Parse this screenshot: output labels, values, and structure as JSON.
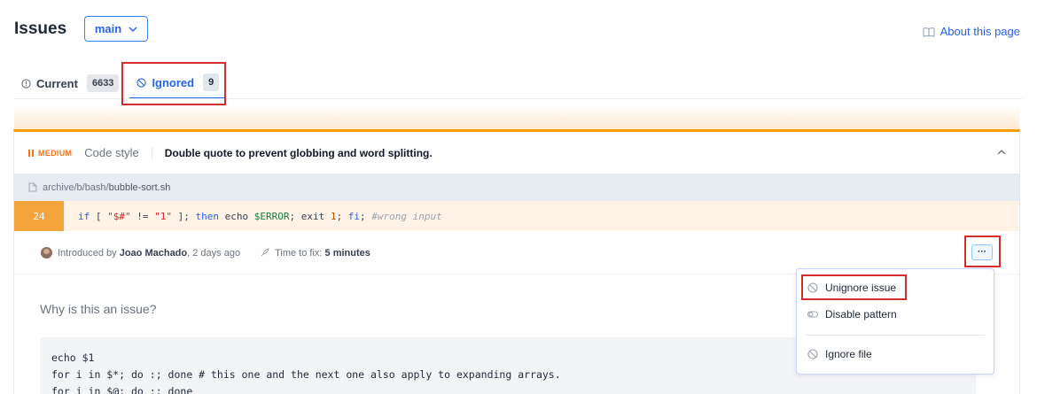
{
  "header": {
    "title": "Issues",
    "branch": "main",
    "about_link": "About this page"
  },
  "tabs": [
    {
      "label": "Current",
      "count": "6633",
      "icon": "info-icon",
      "active": false
    },
    {
      "label": "Ignored",
      "count": "9",
      "icon": "ban-icon",
      "active": true
    }
  ],
  "issue": {
    "severity": "MEDIUM",
    "category": "Code style",
    "title": "Double quote to prevent globbing and word splitting.",
    "file_path": "archive/b/bash/",
    "file_name": "bubble-sort.sh",
    "line_number": "24",
    "code": {
      "t1": "if",
      "t2": " [ ",
      "t3": "\"$#\"",
      "t4": " != ",
      "t5": "\"1\"",
      "t6": " ]; ",
      "t7": "then",
      "t8": " echo ",
      "t9": "$ERROR",
      "t10": "; exit ",
      "t11": "1",
      "t12": "; ",
      "t13": "fi",
      "t14": "; ",
      "t15": "#wrong input"
    },
    "introduced_prefix": "Introduced by",
    "author": "Joao Machado",
    "introduced_suffix": ", 2 days ago",
    "time_to_fix_label": "Time to fix:",
    "time_to_fix": "5 minutes",
    "more_label": "···",
    "why_heading": "Why is this an issue?",
    "example_code": "echo $1\nfor i in $*; do :; done # this one and the next one also apply to expanding arrays.\nfor i in $@; do :; done"
  },
  "menu": {
    "items": [
      {
        "label": "Unignore issue",
        "icon": "ban-icon"
      },
      {
        "label": "Disable pattern",
        "icon": "toggle-icon"
      },
      {
        "label": "Ignore file",
        "icon": "ban-icon"
      }
    ]
  },
  "colors": {
    "accent": "#2563eb",
    "severity_medium": "#f97316",
    "highlight_line": "#f5a33b",
    "annotation_box": "#d32f2f"
  }
}
